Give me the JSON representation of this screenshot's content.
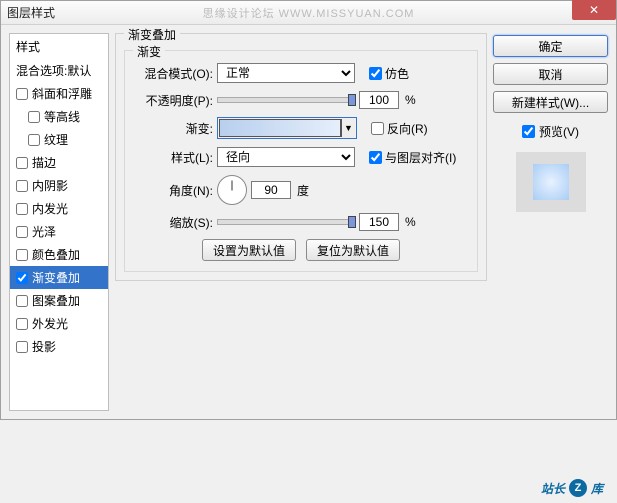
{
  "window": {
    "title": "图层样式",
    "watermark": "思缘设计论坛  WWW.MISSYUAN.COM"
  },
  "sidebar": {
    "header": "样式",
    "blending": "混合选项:默认",
    "items": [
      {
        "label": "斜面和浮雕",
        "checked": false,
        "indent": 0
      },
      {
        "label": "等高线",
        "checked": false,
        "indent": 1
      },
      {
        "label": "纹理",
        "checked": false,
        "indent": 1
      },
      {
        "label": "描边",
        "checked": false,
        "indent": 0
      },
      {
        "label": "内阴影",
        "checked": false,
        "indent": 0
      },
      {
        "label": "内发光",
        "checked": false,
        "indent": 0
      },
      {
        "label": "光泽",
        "checked": false,
        "indent": 0
      },
      {
        "label": "颜色叠加",
        "checked": false,
        "indent": 0
      },
      {
        "label": "渐变叠加",
        "checked": true,
        "indent": 0,
        "selected": true
      },
      {
        "label": "图案叠加",
        "checked": false,
        "indent": 0
      },
      {
        "label": "外发光",
        "checked": false,
        "indent": 0
      },
      {
        "label": "投影",
        "checked": false,
        "indent": 0
      }
    ]
  },
  "panel": {
    "group_title": "渐变叠加",
    "inner_title": "渐变",
    "blend_mode_label": "混合模式(O):",
    "blend_mode_value": "正常",
    "dither_label": "仿色",
    "dither_checked": true,
    "opacity_label": "不透明度(P):",
    "opacity_value": "100",
    "opacity_unit": "%",
    "gradient_label": "渐变:",
    "reverse_label": "反向(R)",
    "reverse_checked": false,
    "style_label": "样式(L):",
    "style_value": "径向",
    "align_label": "与图层对齐(I)",
    "align_checked": true,
    "angle_label": "角度(N):",
    "angle_value": "90",
    "angle_unit": "度",
    "scale_label": "缩放(S):",
    "scale_value": "150",
    "scale_unit": "%",
    "btn_default": "设置为默认值",
    "btn_reset": "复位为默认值"
  },
  "buttons": {
    "ok": "确定",
    "cancel": "取消",
    "new_style": "新建样式(W)...",
    "preview": "预览(V)",
    "preview_checked": true
  },
  "footer": {
    "brand_a": "站长",
    "brand_b": "库"
  }
}
